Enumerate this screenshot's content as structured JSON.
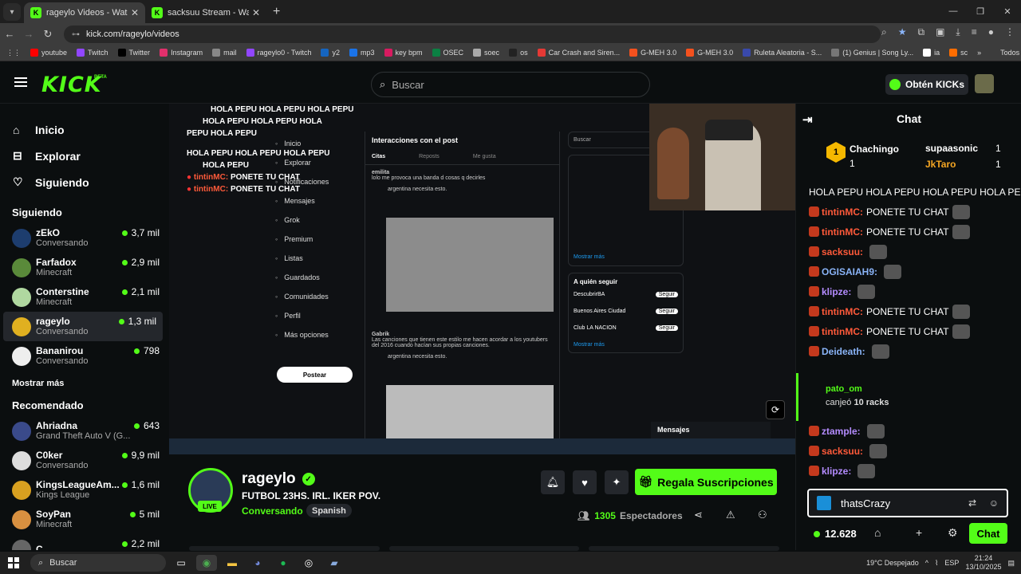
{
  "browser": {
    "tabs": [
      {
        "title": "rageylo Videos - Watch On...",
        "active": true
      },
      {
        "title": "sacksuu Stream - Watch Live on...",
        "active": false
      }
    ],
    "url": "kick.com/rageylo/videos",
    "bookmarks": [
      "youtube",
      "Twitch",
      "Twitter",
      "Instagram",
      "mail",
      "rageylo0 - Twitch",
      "y2",
      "mp3",
      "key bpm",
      "OSEC",
      "soec",
      "os",
      "Car Crash and Siren...",
      "G-MEH 3.0",
      "G-MEH 3.0",
      "Ruleta Aleatoria - S...",
      "(1) Genius | Song Ly...",
      "ia",
      "sc"
    ],
    "bookmarks_folder": "Todos los favoritos"
  },
  "header": {
    "logo": "KICK",
    "logo_badge": "BETA",
    "search_placeholder": "Buscar",
    "kicks_button": "Obtén KICKs"
  },
  "sidebar": {
    "nav": [
      {
        "label": "Inicio",
        "icon": "home-icon"
      },
      {
        "label": "Explorar",
        "icon": "compass-icon"
      },
      {
        "label": "Siguiendo",
        "icon": "heart-icon"
      }
    ],
    "following_title": "Siguiendo",
    "following": [
      {
        "name": "zEkO",
        "game": "Conversando",
        "viewers": "3,7 mil",
        "color": "#1d3d6e"
      },
      {
        "name": "Farfadox",
        "game": "Minecraft",
        "viewers": "2,9 mil",
        "color": "#5a8a3a"
      },
      {
        "name": "Conterstine",
        "game": "Minecraft",
        "viewers": "2,1 mil",
        "color": "#b0d8a0"
      },
      {
        "name": "rageylo",
        "game": "Conversando",
        "viewers": "1,3 mil",
        "color": "#e0b020"
      },
      {
        "name": "Bananirou",
        "game": "Conversando",
        "viewers": "798",
        "color": "#eeeeee"
      }
    ],
    "show_more": "Mostrar más",
    "recommended_title": "Recomendado",
    "recommended": [
      {
        "name": "Ahriadna",
        "game": "Grand Theft Auto V (G...",
        "viewers": "643",
        "color": "#3a4a8a"
      },
      {
        "name": "C0ker",
        "game": "Conversando",
        "viewers": "9,9 mil",
        "color": "#dddddd"
      },
      {
        "name": "KingsLeagueAm...",
        "game": "Kings League",
        "viewers": "1,6 mil",
        "color": "#d8a020"
      },
      {
        "name": "SoyPan",
        "game": "Minecraft",
        "viewers": "5 mil",
        "color": "#d89040"
      },
      {
        "name": "C...",
        "game": "",
        "viewers": "2,2 mil",
        "color": "#666666"
      }
    ]
  },
  "player": {
    "overlay_lines": [
      "HOLA PEPU HOLA PEPU HOLA PEPU",
      "HOLA PEPU HOLA PEPU HOLA",
      "PEPU HOLA PEPU",
      "HOLA PEPU HOLA PEPU HOLA PEPU",
      "HOLA PEPU"
    ],
    "overlay_red": [
      {
        "user": "tintinMC:",
        "text": "PONETE TU CHAT"
      },
      {
        "user": "tintinMC:",
        "text": "PONETE TU CHAT"
      }
    ],
    "x_nav": [
      "Inicio",
      "Explorar",
      "Notificaciones",
      "Mensajes",
      "Grok",
      "Premium",
      "Listas",
      "Guardados",
      "Comunidades",
      "Perfil",
      "Más opciones"
    ],
    "x_post_button": "Postear",
    "x_header": "Interacciones con el post",
    "x_tabs": [
      "Citas",
      "Reposts",
      "Me gusta"
    ],
    "tweet1_user": "emilita",
    "tweet1_text": "lolo me provoca una banda d cosas q decirles",
    "quote1_text": "argentina necesita esto.",
    "tweet2_user": "Gabrik",
    "tweet2_text": "Las canciones que tienen este estilo me hacen acordar a los youtubers del 2016 cuando hacían sus propias canciones.",
    "x_search": "Buscar",
    "x_follow_title": "A quién seguir",
    "x_follow": [
      "DescubrirBA",
      "Buenos Aires Ciudad",
      "Club LA NACION"
    ],
    "x_follow_btn": "Seguir",
    "x_messages": "Mensajes",
    "x_show_more": "Mostrar más"
  },
  "stream": {
    "name": "rageylo",
    "live": "LIVE",
    "title": "FUTBOL 23HS. IRL. IKER POV.",
    "category": "Conversando",
    "language": "Spanish",
    "subs_button": "Regala Suscripciones",
    "viewers_count": "1305",
    "viewers_label": "Espectadores"
  },
  "chat": {
    "title": "Chat",
    "gifters": [
      {
        "name": "Chachingo",
        "count": "1",
        "rank": "1"
      },
      {
        "name": "supaasonic",
        "count": "1"
      },
      {
        "name": "JkTaro",
        "count": "1"
      }
    ],
    "messages": [
      {
        "user": "",
        "text": "HOLA PEPU HOLA PEPU HOLA PEPU HOLA PEPU",
        "color": "#ffffff"
      },
      {
        "user": "tintinMC:",
        "text": "PONETE TU CHAT",
        "color": "#ff5a3a"
      },
      {
        "user": "tintinMC:",
        "text": "PONETE TU CHAT",
        "color": "#ff5a3a"
      },
      {
        "user": "sacksuu:",
        "text": "",
        "color": "#ff5a3a"
      },
      {
        "user": "OGISAIAH9:",
        "text": "",
        "color": "#8ab4f8"
      },
      {
        "user": "klipze:",
        "text": "",
        "color": "#b48cff"
      },
      {
        "user": "tintinMC:",
        "text": "PONETE TU CHAT",
        "color": "#ff5a3a"
      },
      {
        "user": "tintinMC:",
        "text": "PONETE TU CHAT",
        "color": "#ff5a3a"
      },
      {
        "user": "Deideath:",
        "text": "",
        "color": "#8ab4f8"
      }
    ],
    "redeem_user": "pato_om",
    "redeem_text": "canjeó",
    "redeem_reward": "10 racks",
    "messages2": [
      {
        "user": "ztample:",
        "text": "",
        "color": "#b48cff"
      },
      {
        "user": "sacksuu:",
        "text": "",
        "color": "#ff5a3a"
      },
      {
        "user": "klipze:",
        "text": "",
        "color": "#b48cff"
      }
    ],
    "input_value": "thatsCrazy",
    "points": "12.628",
    "send_button": "Chat"
  },
  "taskbar": {
    "search": "Buscar",
    "weather": "19°C Despejado",
    "lang": "ESP",
    "time": "21:24",
    "date": "13/10/2025"
  }
}
